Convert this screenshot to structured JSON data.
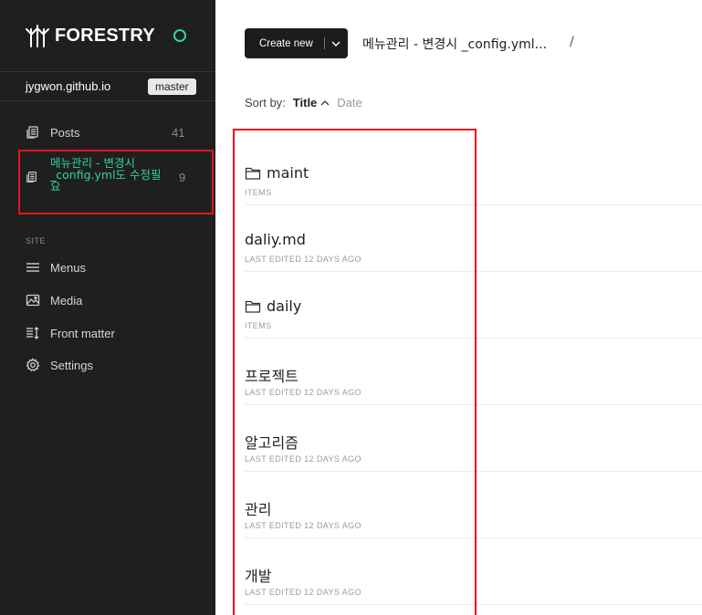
{
  "brand": {
    "name": "FORESTRY",
    "status_color": "#2fd3a0"
  },
  "site": {
    "name": "jygwon.github.io",
    "branch": "master"
  },
  "sidebar": {
    "content_items": [
      {
        "label": "Posts",
        "count": "41",
        "icon": "document-stack-icon"
      },
      {
        "label": "메뉴관리 - 변경시 _config.yml도 수정필요",
        "count": "9",
        "icon": "document-stack-icon",
        "active": true
      }
    ],
    "section_label": "SITE",
    "site_items": [
      {
        "label": "Menus",
        "icon": "hamburger-icon"
      },
      {
        "label": "Media",
        "icon": "image-icon"
      },
      {
        "label": "Front matter",
        "icon": "front-matter-icon"
      },
      {
        "label": "Settings",
        "icon": "gear-icon"
      }
    ]
  },
  "toolbar": {
    "create_label": "Create new"
  },
  "breadcrumb": {
    "current": "메뉴관리 - 변경시 _config.yml...",
    "separator": "/"
  },
  "sort": {
    "label": "Sort by:",
    "active": "Title",
    "other": "Date"
  },
  "items": [
    {
      "name": "maint",
      "meta": "ITEMS",
      "type": "folder"
    },
    {
      "name": "daliy.md",
      "meta": "LAST EDITED 12 DAYS AGO",
      "type": "file"
    },
    {
      "name": "daily",
      "meta": "ITEMS",
      "type": "folder"
    },
    {
      "name": "프로젝트",
      "meta": "LAST EDITED 12 DAYS AGO",
      "type": "file"
    },
    {
      "name": "알고리즘",
      "meta": "LAST EDITED 12 DAYS AGO",
      "type": "file"
    },
    {
      "name": "관리",
      "meta": "LAST EDITED 12 DAYS AGO",
      "type": "file"
    },
    {
      "name": "개발",
      "meta": "LAST EDITED 12 DAYS AGO",
      "type": "file"
    }
  ],
  "colors": {
    "accent": "#2fd3a0",
    "highlight": "#e3141b",
    "sidebar_bg": "#1f1f1f"
  }
}
